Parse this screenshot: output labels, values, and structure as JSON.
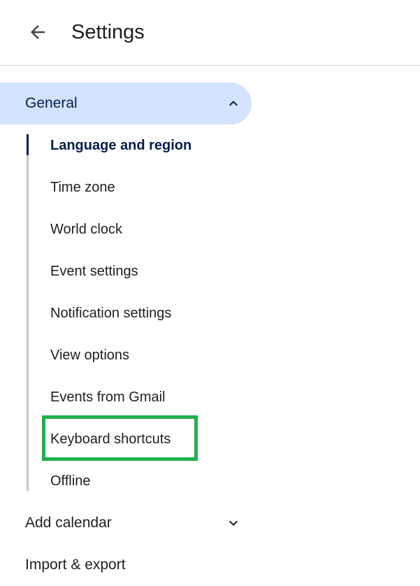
{
  "header": {
    "title": "Settings",
    "back_icon": "arrow-back-icon"
  },
  "sections": {
    "general": {
      "label": "General",
      "expanded": true,
      "chevron_icon": "chevron-up-icon",
      "items": [
        {
          "label": "Language and region",
          "active": true
        },
        {
          "label": "Time zone",
          "active": false
        },
        {
          "label": "World clock",
          "active": false
        },
        {
          "label": "Event settings",
          "active": false
        },
        {
          "label": "Notification settings",
          "active": false
        },
        {
          "label": "View options",
          "active": false
        },
        {
          "label": "Events from Gmail",
          "active": false
        },
        {
          "label": "Keyboard shortcuts",
          "active": false,
          "highlighted": true
        },
        {
          "label": "Offline",
          "active": false
        }
      ]
    },
    "add_calendar": {
      "label": "Add calendar",
      "expanded": false,
      "chevron_icon": "chevron-down-icon"
    },
    "import_export": {
      "label": "Import & export"
    }
  },
  "colors": {
    "accent_bg": "#d3e3fd",
    "accent_text": "#041e49",
    "highlight": "#21b04b"
  }
}
